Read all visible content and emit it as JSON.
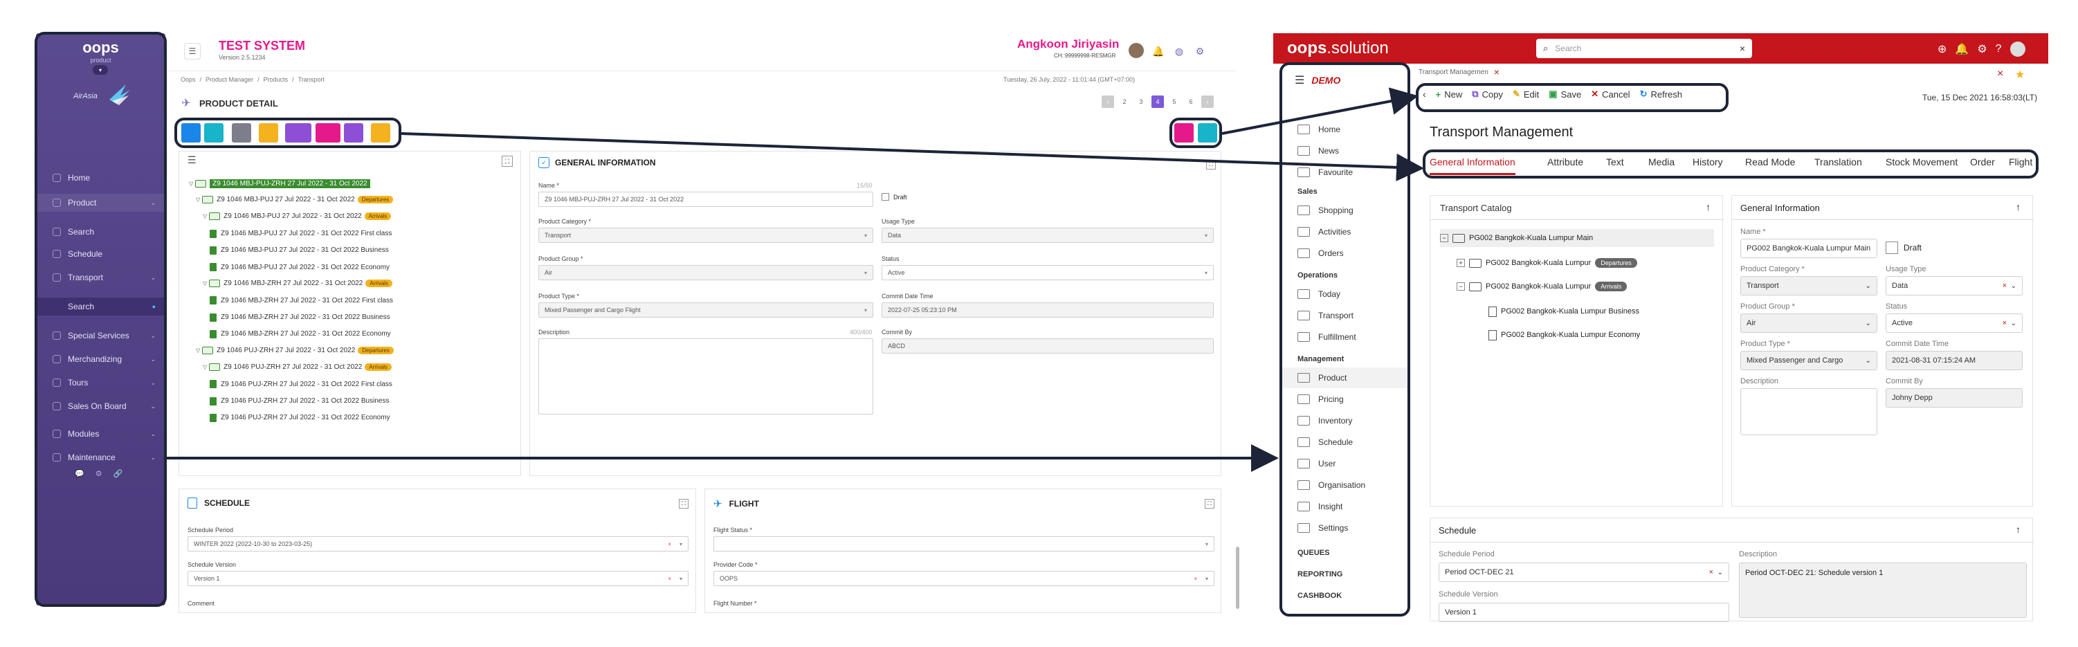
{
  "left": {
    "brand": {
      "name": "oops",
      "tagline": "product",
      "partner_logo": "AirAsia"
    },
    "sidebar": {
      "items": [
        {
          "label": "Home",
          "icon": "home-icon"
        },
        {
          "label": "Product",
          "icon": "product-icon",
          "active": true
        },
        {
          "label": "Search",
          "icon": "search-icon"
        },
        {
          "label": "Schedule",
          "icon": "schedule-icon"
        },
        {
          "label": "Transport",
          "icon": "transport-icon"
        },
        {
          "label": "Search",
          "icon": "search-icon",
          "sub": true
        },
        {
          "label": "Special Services",
          "icon": "services-icon"
        },
        {
          "label": "Merchandizing",
          "icon": "merch-icon"
        },
        {
          "label": "Tours",
          "icon": "tours-icon"
        },
        {
          "label": "Sales On Board",
          "icon": "sales-icon"
        },
        {
          "label": "Modules",
          "icon": "modules-icon"
        },
        {
          "label": "Maintenance",
          "icon": "maintenance-icon"
        }
      ]
    },
    "header": {
      "system_title": "TEST SYSTEM",
      "version": "Version 2.5.1234",
      "user_name": "Angkoon Jiriyasin",
      "user_id": "CH::99999998-RESMGR",
      "datetime": "Tuesday, 26 July, 2022 - 11:01:44 (GMT+07:00)"
    },
    "breadcrumb": [
      "Oops",
      "Product Manager",
      "Products",
      "Transport"
    ],
    "page_title": "PRODUCT DETAIL",
    "pagination": [
      "2",
      "3",
      "4",
      "5",
      "6"
    ],
    "active_page": "4",
    "tree": [
      {
        "label": "Z9 1046 MBJ-PUJ-ZRH 27 Jul 2022 - 31 Oct 2022",
        "level": 0,
        "type": "root"
      },
      {
        "label": "Z9 1046 MBJ-PUJ 27 Jul 2022 - 31 Oct 2022",
        "level": 1,
        "type": "folder",
        "badge": "Departures"
      },
      {
        "label": "Z9 1046 MBJ-PUJ 27 Jul 2022 - 31 Oct 2022",
        "level": 2,
        "type": "folder",
        "badge": "Arrivals"
      },
      {
        "label": "Z9 1046 MBJ-PUJ 27 Jul 2022 - 31 Oct 2022 First class",
        "level": 3,
        "type": "leaf"
      },
      {
        "label": "Z9 1046 MBJ-PUJ 27 Jul 2022 - 31 Oct 2022 Business",
        "level": 3,
        "type": "leaf"
      },
      {
        "label": "Z9 1046 MBJ-PUJ 27 Jul 2022 - 31 Oct 2022 Economy",
        "level": 3,
        "type": "leaf"
      },
      {
        "label": "Z9 1046 MBJ-ZRH 27 Jul 2022 - 31 Oct 2022",
        "level": 2,
        "type": "folder",
        "badge": "Arrivals"
      },
      {
        "label": "Z9 1046 MBJ-ZRH 27 Jul 2022 - 31 Oct 2022 First class",
        "level": 3,
        "type": "leaf"
      },
      {
        "label": "Z9 1046 MBJ-ZRH 27 Jul 2022 - 31 Oct 2022 Business",
        "level": 3,
        "type": "leaf"
      },
      {
        "label": "Z9 1046 MBJ-ZRH 27 Jul 2022 - 31 Oct 2022 Economy",
        "level": 3,
        "type": "leaf"
      },
      {
        "label": "Z9 1046 PUJ-ZRH 27 Jul 2022 - 31 Oct 2022",
        "level": 1,
        "type": "folder",
        "badge": "Departures"
      },
      {
        "label": "Z9 1046 PUJ-ZRH 27 Jul 2022 - 31 Oct 2022",
        "level": 2,
        "type": "folder",
        "badge": "Arrivals"
      },
      {
        "label": "Z9 1046 PUJ-ZRH 27 Jul 2022 - 31 Oct 2022 First class",
        "level": 3,
        "type": "leaf"
      },
      {
        "label": "Z9 1046 PUJ-ZRH 27 Jul 2022 - 31 Oct 2022 Business",
        "level": 3,
        "type": "leaf"
      },
      {
        "label": "Z9 1046 PUJ-ZRH 27 Jul 2022 - 31 Oct 2022 Economy",
        "level": 3,
        "type": "leaf"
      }
    ],
    "general": {
      "title": "GENERAL INFORMATION",
      "name_label": "Name *",
      "name_count": "15/50",
      "name_value": "Z9 1046 MBJ-PUJ-ZRH 27 Jul 2022 - 31 Oct 2022",
      "draft_label": "Draft",
      "category_label": "Product Category *",
      "category_value": "Transport",
      "usage_label": "Usage Type",
      "usage_value": "Data",
      "group_label": "Product Group *",
      "group_value": "Air",
      "status_label": "Status",
      "status_value": "Active",
      "type_label": "Product Type *",
      "type_value": "Mixed Passenger and Cargo Flight",
      "commit_dt_label": "Commit Date Time",
      "commit_dt_value": "2022-07-25 05:23:10 PM",
      "desc_label": "Description",
      "desc_count": "400/400",
      "commit_by_label": "Commit By",
      "commit_by_value": "ABCD"
    },
    "schedule": {
      "title": "SCHEDULE",
      "period_label": "Schedule Period",
      "period_value": "WINTER 2022 (2022-10-30 to 2023-03-25)",
      "version_label": "Schedule Version",
      "version_value": "Version 1",
      "comment_label": "Comment"
    },
    "flight": {
      "title": "FLIGHT",
      "status_label": "Flight Status *",
      "status_value": "",
      "provider_label": "Provider Code *",
      "provider_value": "OOPS",
      "number_label": "Flight Number *"
    },
    "colors": {
      "accent": "#e6198a",
      "sidebar": "#4f3f82",
      "tree_green": "#3a8d2f"
    }
  },
  "right": {
    "brand": {
      "bold": "oops",
      "light": ".solution"
    },
    "search_placeholder": "Search",
    "demo_logo": "DEMO",
    "tab_title": "Transport Managemen",
    "toolbar": [
      "New",
      "Copy",
      "Edit",
      "Save",
      "Cancel",
      "Refresh"
    ],
    "datetime": "Tue, 15 Dec 2021 16:58:03(LT)",
    "page_title": "Transport Management",
    "tabs": [
      "General Information",
      "Attribute",
      "Text",
      "Media",
      "History",
      "Read Mode",
      "Translation",
      "Stock Movement",
      "Order",
      "Flight"
    ],
    "sidebar": {
      "top": [
        {
          "label": "Home",
          "icon": "home-icon"
        },
        {
          "label": "News",
          "icon": "news-icon"
        },
        {
          "label": "Favourite",
          "icon": "star-icon"
        }
      ],
      "sections": [
        {
          "title": "Sales",
          "items": [
            {
              "label": "Shopping",
              "icon": "tag-icon"
            },
            {
              "label": "Activities",
              "icon": "activity-icon"
            },
            {
              "label": "Orders",
              "icon": "orders-icon"
            }
          ]
        },
        {
          "title": "Operations",
          "items": [
            {
              "label": "Today",
              "icon": "calendar-icon"
            },
            {
              "label": "Transport",
              "icon": "plane-icon"
            },
            {
              "label": "Fulfillment",
              "icon": "truck-icon"
            }
          ]
        },
        {
          "title": "Management",
          "items": [
            {
              "label": "Product",
              "icon": "box-icon"
            },
            {
              "label": "Pricing",
              "icon": "pricing-icon"
            },
            {
              "label": "Inventory",
              "icon": "inventory-icon"
            },
            {
              "label": "Schedule",
              "icon": "schedule-icon"
            },
            {
              "label": "User",
              "icon": "user-icon"
            },
            {
              "label": "Organisation",
              "icon": "org-icon"
            },
            {
              "label": "Insight",
              "icon": "insight-icon"
            },
            {
              "label": "Settings",
              "icon": "settings-icon"
            }
          ]
        }
      ],
      "bottom": [
        "QUEUES",
        "REPORTING",
        "CASHBOOK"
      ]
    },
    "catalog": {
      "title": "Transport Catalog",
      "items": [
        {
          "label": "PG002 Bangkok-Kuala Lumpur Main",
          "level": 0
        },
        {
          "label": "PG002 Bangkok-Kuala Lumpur",
          "level": 1,
          "badge": "Departures"
        },
        {
          "label": "PG002 Bangkok-Kuala Lumpur",
          "level": 1,
          "badge": "Arrivals"
        },
        {
          "label": "PG002 Bangkok-Kuala Lumpur  Business",
          "level": 2
        },
        {
          "label": "PG002 Bangkok-Kuala Lumpur  Economy",
          "level": 2
        }
      ]
    },
    "general": {
      "title": "General Information",
      "name_label": "Name *",
      "name_value": "PG002 Bangkok-Kuala Lumpur Main",
      "draft_label": "Draft",
      "category_label": "Product Category *",
      "category_value": "Transport",
      "usage_label": "Usage Type",
      "usage_value": "Data",
      "group_label": "Product Group *",
      "group_value": "Air",
      "status_label": "Status",
      "status_value": "Active",
      "type_label": "Product Type *",
      "type_value": "Mixed Passenger and Cargo",
      "commit_dt_label": "Commit Date Time",
      "commit_dt_value": "2021-08-31 07:15:24 AM",
      "desc_label": "Description",
      "commit_by_label": "Commit By",
      "commit_by_value": "Johny Depp"
    },
    "schedule": {
      "title": "Schedule",
      "period_label": "Schedule Period",
      "period_value": "Period OCT-DEC 21",
      "desc_label": "Description",
      "desc_value": "Period OCT-DEC 21: Schedule version 1",
      "version_label": "Schedule Version",
      "version_value": "Version 1"
    },
    "colors": {
      "topbar": "#c4161c",
      "active_tab": "#c4161c"
    }
  }
}
